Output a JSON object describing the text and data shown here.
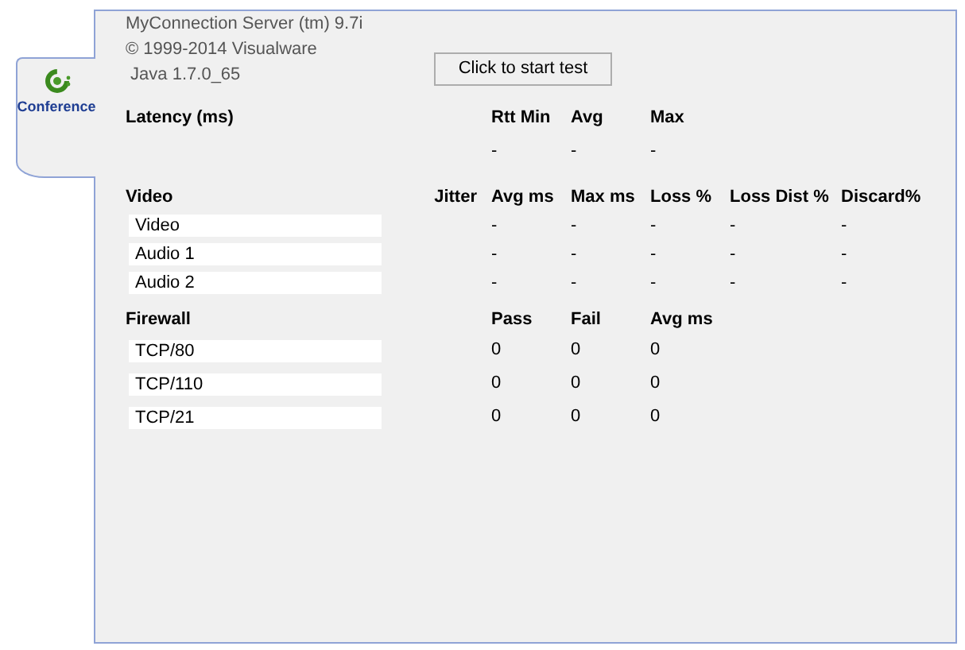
{
  "tab": {
    "label": "Conference",
    "selected": true
  },
  "about": [
    "MyConnection Server (tm) 9.7i",
    "© 1999-2014 Visualware",
    " Java 1.7.0_65"
  ],
  "start_button": "Click to start test",
  "latency": {
    "title": "Latency (ms)",
    "columns": [
      "Rtt Min",
      "Avg",
      "Max"
    ],
    "values": [
      "-",
      "-",
      "-"
    ]
  },
  "video": {
    "title": "Video",
    "jitter_label": "Jitter",
    "columns": [
      "Avg ms",
      "Max ms",
      "Loss %",
      "Loss Dist %",
      "Discard%"
    ],
    "rows": [
      {
        "name": "Video",
        "values": [
          "-",
          "-",
          "-",
          "-",
          "-"
        ]
      },
      {
        "name": "Audio 1",
        "values": [
          "-",
          "-",
          "-",
          "-",
          "-"
        ]
      },
      {
        "name": "Audio 2",
        "values": [
          "-",
          "-",
          "-",
          "-",
          "-"
        ]
      }
    ]
  },
  "firewall": {
    "title": "Firewall",
    "columns": [
      "Pass",
      "Fail",
      "Avg ms"
    ],
    "rows": [
      {
        "name": "TCP/80",
        "values": [
          "0",
          "0",
          "0"
        ]
      },
      {
        "name": "TCP/110",
        "values": [
          "0",
          "0",
          "0"
        ]
      },
      {
        "name": "TCP/21",
        "values": [
          "0",
          "0",
          "0"
        ]
      }
    ]
  }
}
